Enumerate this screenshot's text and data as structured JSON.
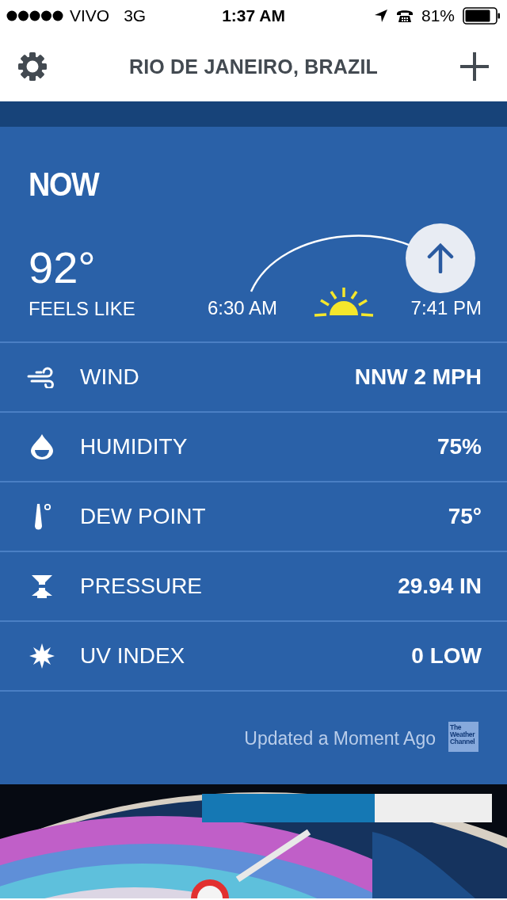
{
  "status_bar": {
    "carrier": "VIVO",
    "network": "3G",
    "time": "1:37 AM",
    "battery": "81%"
  },
  "header": {
    "title": "RIO DE JANEIRO, BRAZIL"
  },
  "now": {
    "heading": "NOW",
    "temperature": "92°",
    "feels_like": "FEELS LIKE",
    "sunrise": "6:30 AM",
    "sunset": "7:41 PM"
  },
  "details": [
    {
      "kind": "wind",
      "label": "WIND",
      "value": "NNW 2 MPH"
    },
    {
      "kind": "humidity",
      "label": "HUMIDITY",
      "value": "75%"
    },
    {
      "kind": "dew_point",
      "label": "DEW POINT",
      "value": "75°"
    },
    {
      "kind": "pressure",
      "label": "PRESSURE",
      "value": "29.94 IN"
    },
    {
      "kind": "uv",
      "label": "UV INDEX",
      "value": "0 LOW"
    }
  ],
  "footer": {
    "updated": "Updated a Moment Ago",
    "logo_text": "The Weather Channel"
  }
}
